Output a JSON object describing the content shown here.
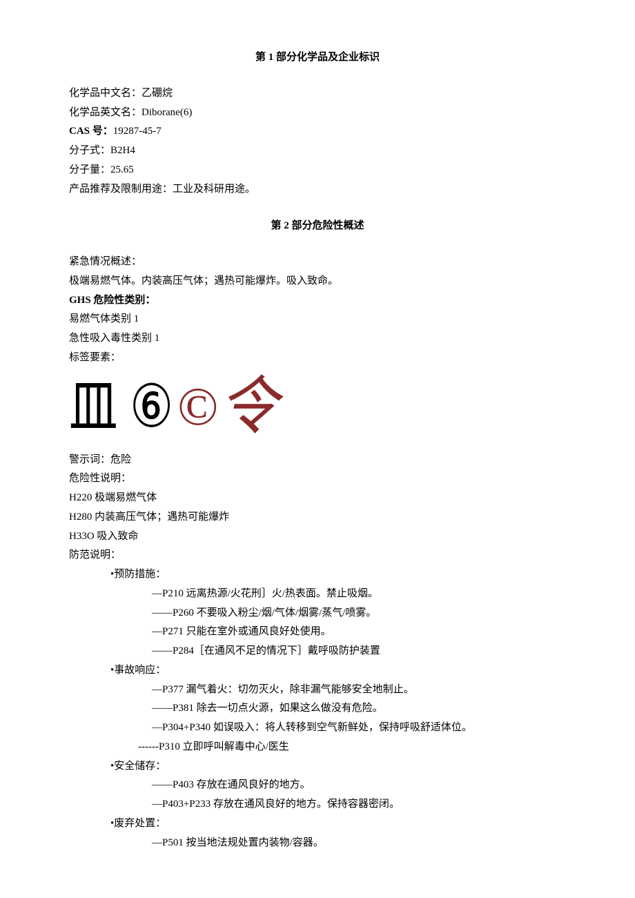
{
  "section1": {
    "title": "第 1 部分化学品及企业标识",
    "fields": {
      "name_cn_label": "化学品中文名：",
      "name_cn": "乙硼烷",
      "name_en_label": "化学品英文名：",
      "name_en": "Diborane(6)",
      "cas_label": "CAS 号：",
      "cas": "19287-45-7",
      "formula_label": "分子式：",
      "formula": "B2H4",
      "mw_label": "分子量：",
      "mw": "25.65",
      "use_label": "产品推荐及限制用途：",
      "use": "工业及科研用途。"
    }
  },
  "section2": {
    "title": "第 2 部分危险性概述",
    "emer_label": "紧急情况概述：",
    "emer_text": "极端易燃气体。内装高压气体；遇热可能爆炸。吸入致命。",
    "ghs_label": "GHS 危险性类别：",
    "ghs_lines": [
      "易燃气体类别 1",
      "急性吸入毒性类别 1"
    ],
    "label_elements": "标签要素：",
    "pictos": {
      "a": "皿",
      "b": "⑥",
      "c": "©",
      "d": "令"
    },
    "signal_label": "警示词：",
    "signal": "危险",
    "haz_label": "危险性说明：",
    "haz": [
      "H220 极端易燃气体",
      "H280 内装高压气体；遇热可能爆炸",
      "H33O 吸入致命"
    ],
    "precaution_label": "防范说明：",
    "groups": [
      {
        "heading": "•预防措施：",
        "items": [
          "—P210 远离热源/火花刑］火/热表面。禁止吸烟。",
          "——P260 不要吸入粉尘/烟/气体/烟雾/蒸气/喷雾。",
          "—P271 只能在室外或通风良好处使用。",
          "——P284［在通风不足的情况下］戴呼吸防护装置"
        ]
      },
      {
        "heading": "•事故响应：",
        "items": [
          "—P377 漏气着火：切勿灭火，除非漏气能够安全地制止。",
          "——P381 除去一切点火源，如果这么做没有危险。",
          "—P304+P340 如误吸入：将人转移到空气新鲜处，保持呼吸舒适体位。",
          "------P310 立即呼叫解毒中心/医生"
        ]
      },
      {
        "heading": "•安全储存：",
        "items": [
          "——P403 存放在通风良好的地方。",
          "—P403+P233 存放在通风良好的地方。保持容器密闭。"
        ]
      },
      {
        "heading": "•废弃处置：",
        "items": [
          "—P501 按当地法规处置内装物/容器。"
        ]
      }
    ]
  }
}
